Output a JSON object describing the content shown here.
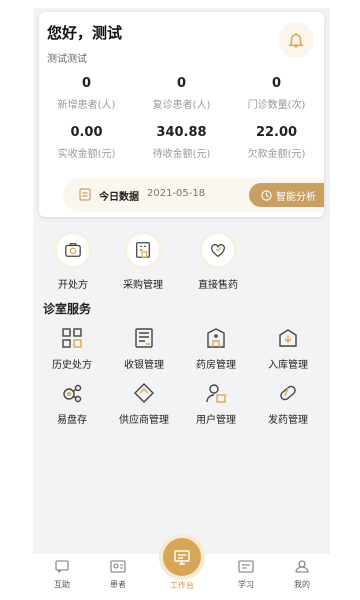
{
  "header": {
    "greeting": "您好，测试",
    "clinic_name": "测试测试"
  },
  "stats": [
    {
      "value": "0",
      "label": "新增患者(人)"
    },
    {
      "value": "0",
      "label": "复诊患者(人)"
    },
    {
      "value": "0",
      "label": "门诊数量(次)"
    },
    {
      "value": "0.00",
      "label": "实收金额(元)"
    },
    {
      "value": "340.88",
      "label": "待收金额(元)"
    },
    {
      "value": "22.00",
      "label": "欠款金额(元)"
    }
  ],
  "today": {
    "label": "今日数据",
    "date": "2021-05-18",
    "analyze_label": "智能分析"
  },
  "quick_actions": [
    {
      "label": "开处方",
      "icon": "prescription-icon"
    },
    {
      "label": "采购管理",
      "icon": "purchase-icon"
    },
    {
      "label": "直接售药",
      "icon": "sell-medicine-icon"
    }
  ],
  "section": {
    "title": "诊室服务"
  },
  "services": [
    {
      "label": "历史处方",
      "icon": "history-prescription-icon"
    },
    {
      "label": "收银管理",
      "icon": "cashier-icon"
    },
    {
      "label": "药房管理",
      "icon": "pharmacy-icon"
    },
    {
      "label": "入库管理",
      "icon": "stock-in-icon"
    },
    {
      "label": "易盘存",
      "icon": "inventory-icon"
    },
    {
      "label": "供应商管理",
      "icon": "supplier-icon"
    },
    {
      "label": "用户管理",
      "icon": "user-management-icon"
    },
    {
      "label": "发药管理",
      "icon": "dispense-icon"
    }
  ],
  "nav": {
    "items": [
      {
        "label": "互助",
        "icon": "chat-icon"
      },
      {
        "label": "患者",
        "icon": "patient-icon"
      },
      {
        "label": "工作台",
        "icon": "workbench-icon"
      },
      {
        "label": "学习",
        "icon": "study-icon"
      },
      {
        "label": "我的",
        "icon": "profile-icon"
      }
    ]
  },
  "colors": {
    "accent": "#c9a063",
    "icon_stroke": "#444444",
    "nav_active": "#d7a657"
  }
}
